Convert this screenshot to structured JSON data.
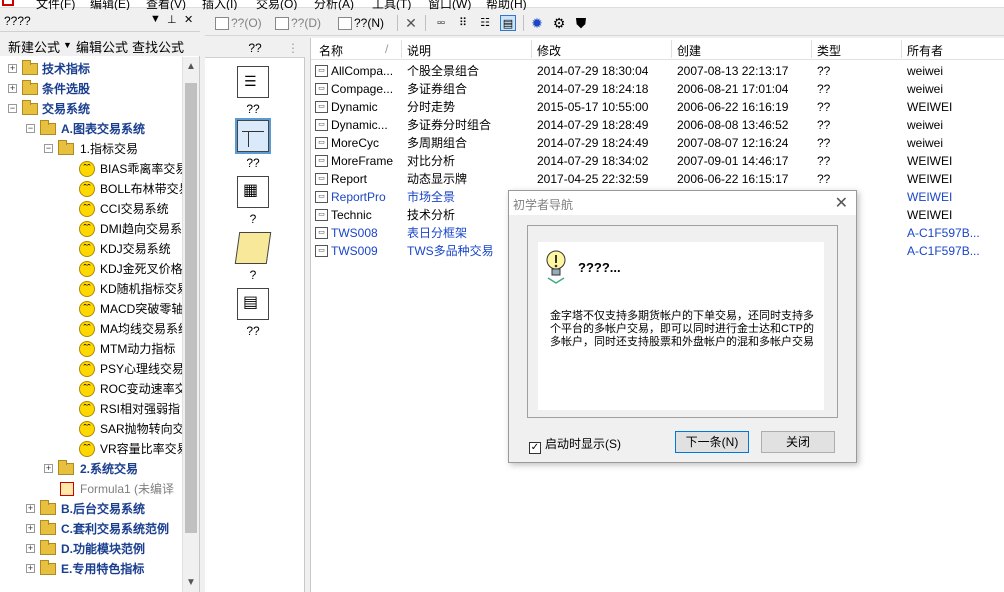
{
  "menubar": {
    "items": [
      "文件(F)",
      "编辑(E)",
      "查看(V)",
      "插入(I)",
      "交易(O)",
      "分析(A)",
      "工具(T)",
      "窗口(W)",
      "帮助(H)"
    ]
  },
  "left_panel": {
    "title": "????",
    "tabs": [
      "新建公式",
      "编辑公式",
      "查找公式"
    ],
    "tree": [
      {
        "label": "技术指标"
      },
      {
        "label": "条件选股"
      },
      {
        "label": "交易系统"
      },
      {
        "label": "A.图表交易系统"
      },
      {
        "label": "1.指标交易"
      },
      {
        "label": "BIAS乖离率交易"
      },
      {
        "label": "BOLL布林带交易"
      },
      {
        "label": "CCI交易系统"
      },
      {
        "label": "DMI趋向交易系"
      },
      {
        "label": "KDJ交易系统"
      },
      {
        "label": "KDJ金死叉价格"
      },
      {
        "label": "KD随机指标交易"
      },
      {
        "label": "MACD突破零轴"
      },
      {
        "label": "MA均线交易系统"
      },
      {
        "label": "MTM动力指标"
      },
      {
        "label": "PSY心理线交易"
      },
      {
        "label": "ROC变动速率交"
      },
      {
        "label": "RSI相对强弱指"
      },
      {
        "label": "SAR抛物转向交"
      },
      {
        "label": "VR容量比率交易"
      },
      {
        "label": "2.系统交易"
      },
      {
        "label": "Formula1 (未编译"
      },
      {
        "label": "B.后台交易系统"
      },
      {
        "label": "C.套利交易系统范例"
      },
      {
        "label": "D.功能模块范例"
      },
      {
        "label": "E.专用特色指标"
      }
    ]
  },
  "toolbar": {
    "btn1": "??(O)",
    "btn2": "??(D)",
    "btn3": "??(N)"
  },
  "mid_panel": {
    "header": "??",
    "items": [
      {
        "label": "??"
      },
      {
        "label": "??"
      },
      {
        "label": "?"
      },
      {
        "label": "?"
      },
      {
        "label": "??"
      }
    ]
  },
  "list": {
    "columns": [
      "名称",
      "说明",
      "修改",
      "创建",
      "类型",
      "所有者"
    ],
    "rows": [
      {
        "name": "AllCompa...",
        "desc": "个股全景组合",
        "modified": "2014-07-29 18:30:04",
        "created": "2007-08-13 22:13:17",
        "type": "??",
        "owner": "weiwei"
      },
      {
        "name": "Compage...",
        "desc": "多证券组合",
        "modified": "2014-07-29 18:24:18",
        "created": "2006-08-21 17:01:04",
        "type": "??",
        "owner": "weiwei"
      },
      {
        "name": "Dynamic",
        "desc": "分时走势",
        "modified": "2015-05-17 10:55:00",
        "created": "2006-06-22 16:16:19",
        "type": "??",
        "owner": "WEIWEI"
      },
      {
        "name": "Dynamic...",
        "desc": "多证券分时组合",
        "modified": "2014-07-29 18:28:49",
        "created": "2006-08-08 13:46:52",
        "type": "??",
        "owner": "weiwei"
      },
      {
        "name": "MoreCyc",
        "desc": "多周期组合",
        "modified": "2014-07-29 18:24:49",
        "created": "2007-08-07 12:16:24",
        "type": "??",
        "owner": "weiwei"
      },
      {
        "name": "MoreFrame",
        "desc": "对比分析",
        "modified": "2014-07-29 18:34:02",
        "created": "2007-09-01 14:46:17",
        "type": "??",
        "owner": "WEIWEI"
      },
      {
        "name": "Report",
        "desc": "动态显示牌",
        "modified": "2017-04-25 22:32:59",
        "created": "2006-06-22 16:15:17",
        "type": "??",
        "owner": "WEIWEI"
      },
      {
        "name": "ReportPro",
        "desc": "市场全景",
        "modified": "",
        "created": "",
        "type": "",
        "owner": "WEIWEI"
      },
      {
        "name": "Technic",
        "desc": "技术分析",
        "modified": "",
        "created": "",
        "type": "",
        "owner": "WEIWEI"
      },
      {
        "name": "TWS008",
        "desc": "表日分框架",
        "modified": "",
        "created": "",
        "type": "",
        "owner": "A-C1F597B..."
      },
      {
        "name": "TWS009",
        "desc": "TWS多品种交易",
        "modified": "",
        "created": "",
        "type": "",
        "owner": "A-C1F597B..."
      }
    ]
  },
  "dialog": {
    "title": "初学者导航",
    "close_symbol": "✕",
    "heading": "????...",
    "text": "金字塔不仅支持多期货帐户的下单交易，还同时支持多个平台的多帐户交易，即可以同时进行金士达和CTP的多帐户，同时还支持股票和外盘帐户的混和多帐户交易",
    "checkbox_label": "启动时显示(S)",
    "next_button": "下一条(N)",
    "close_button": "关闭"
  }
}
